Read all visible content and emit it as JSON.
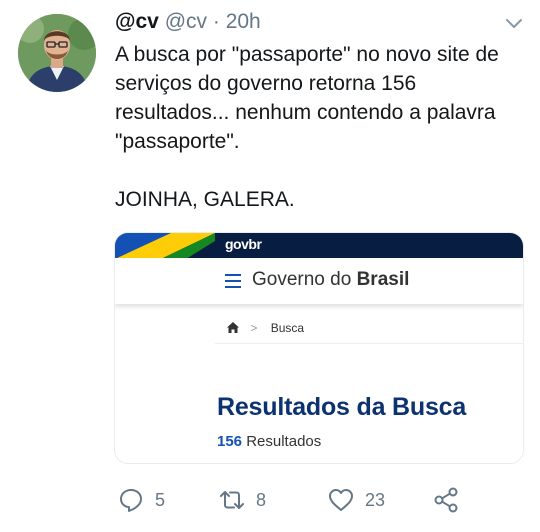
{
  "tweet": {
    "display_name": "@cv",
    "handle": "@cv",
    "separator": "·",
    "time": "20h",
    "text": "A busca por \"passaporte\" no novo site de serviços do governo retorna 156 resultados... nenhum contendo a palavra \"passaporte\".\n\nJOINHA, GALERA.",
    "menu_icon": "chevron-down-icon"
  },
  "card": {
    "logo": "govbr",
    "site_title_prefix": "Governo do ",
    "site_title_bold": "Brasil",
    "breadcrumb": {
      "home_icon": "home-icon",
      "separator": ">",
      "current": "Busca"
    },
    "results_title": "Resultados da Busca",
    "results_count": "156",
    "results_label": "Resultados"
  },
  "actions": {
    "reply_count": "5",
    "retweet_count": "8",
    "like_count": "23",
    "share_icon": "share-icon"
  },
  "colors": {
    "gov_dark": "#071d41",
    "gov_blue": "#1351b4",
    "title_blue": "#0c326f",
    "muted": "#657786"
  }
}
